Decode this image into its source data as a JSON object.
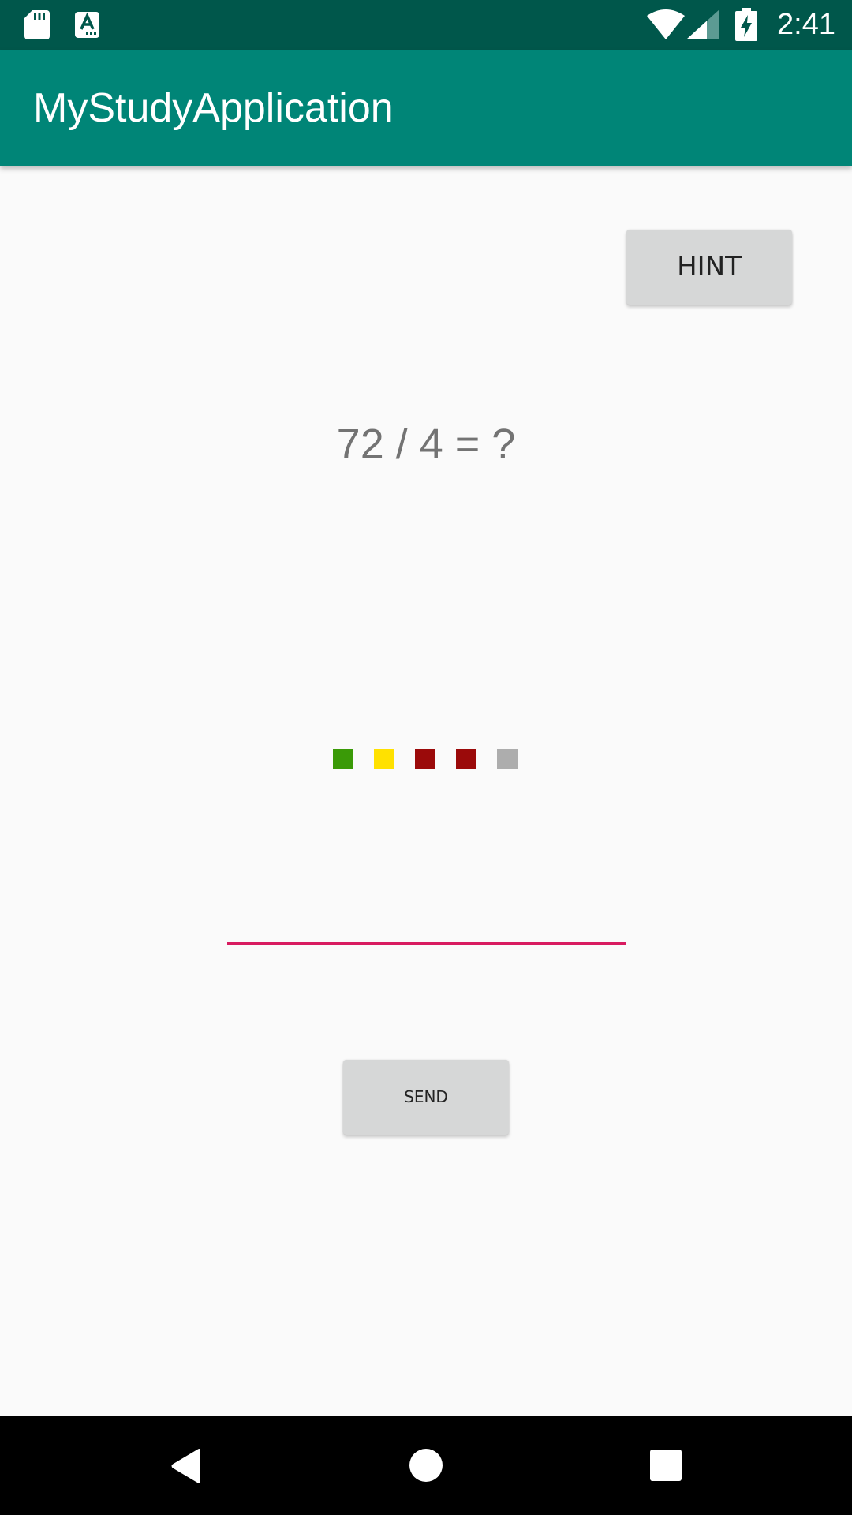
{
  "status_bar": {
    "time": "2:41",
    "icons": [
      "sd-card-icon",
      "a-notification-icon",
      "wifi-icon",
      "signal-icon",
      "battery-charging-icon"
    ]
  },
  "app_bar": {
    "title": "MyStudyApplication"
  },
  "hint_button": {
    "label": "HINT"
  },
  "question": {
    "text": "72 / 4 = ?"
  },
  "progress": {
    "squares": [
      {
        "status": "correct",
        "color": "#3a9a07"
      },
      {
        "status": "hint",
        "color": "#ffe100"
      },
      {
        "status": "wrong",
        "color": "#9b0a0a"
      },
      {
        "status": "wrong",
        "color": "#9b0a0a"
      },
      {
        "status": "pending",
        "color": "#adadad"
      }
    ]
  },
  "answer_input": {
    "value": "",
    "underline_color": "#d81b60"
  },
  "send_button": {
    "label": "SEND"
  },
  "nav_bar": {
    "icons": [
      "back-icon",
      "home-icon",
      "recents-icon"
    ]
  },
  "colors": {
    "status_bar": "#00574b",
    "app_bar": "#008577",
    "background": "#fafafa",
    "button": "#d6d7d7"
  }
}
